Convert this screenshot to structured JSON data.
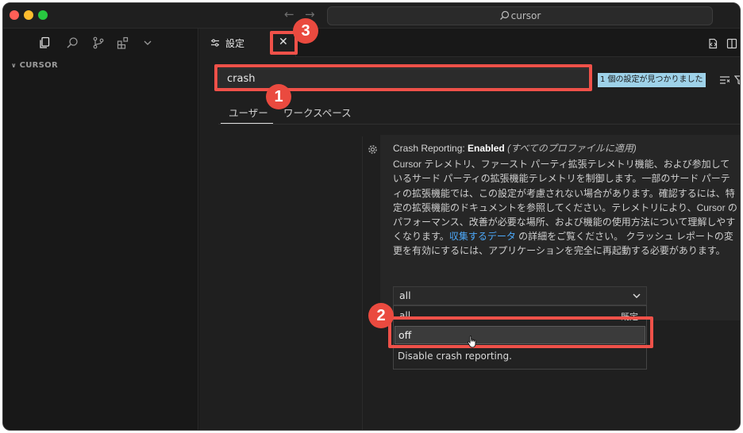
{
  "titlebar": {
    "back_icon": "arrow-left-icon",
    "forward_icon": "arrow-right-icon",
    "search_text": "cursor",
    "traffic_lights": [
      "#ff5f57",
      "#febc2e",
      "#28c840"
    ]
  },
  "sidebar": {
    "activity_icons": [
      "files-icon",
      "search-icon",
      "source-control-icon",
      "extensions-icon",
      "chevron-down-icon"
    ],
    "explorer_title": "CURSOR"
  },
  "editor": {
    "tab_label": "設定",
    "search_value": "crash",
    "found_badge": "1 個の設定が見つかりました",
    "scope_tabs": [
      "ユーザー",
      "ワークスペース"
    ]
  },
  "setting": {
    "title_prefix": "Crash Reporting: ",
    "title_bold": "Enabled",
    "title_scope": "(すべてのプロファイルに適用)",
    "description_before_link": "Cursor テレメトリ、ファースト パーティ拡張テレメトリ機能、および参加しているサード パーティの拡張機能テレメトリを制御します。一部のサード パーティの拡張機能では、この設定が考慮されない場合があります。確認するには、特定の拡張機能のドキュメントを参照してください。テレメトリにより、Cursor のパフォーマンス、改善が必要な場所、および機能の使用方法について理解しやすくなります。",
    "link_text": "収集するデータ",
    "description_after_link": " の詳細をご覧ください。 クラッシュ レポートの変更を有効にするには、アプリケーションを完全に再起動する必要があります。",
    "select_value": "all",
    "options": [
      {
        "label": "all",
        "tag": "既定"
      },
      {
        "label": "off",
        "tag": ""
      }
    ],
    "option_description": "Disable crash reporting."
  },
  "annotations": {
    "markers": [
      "1",
      "2",
      "3"
    ],
    "highlight_color": "#ef5149"
  }
}
